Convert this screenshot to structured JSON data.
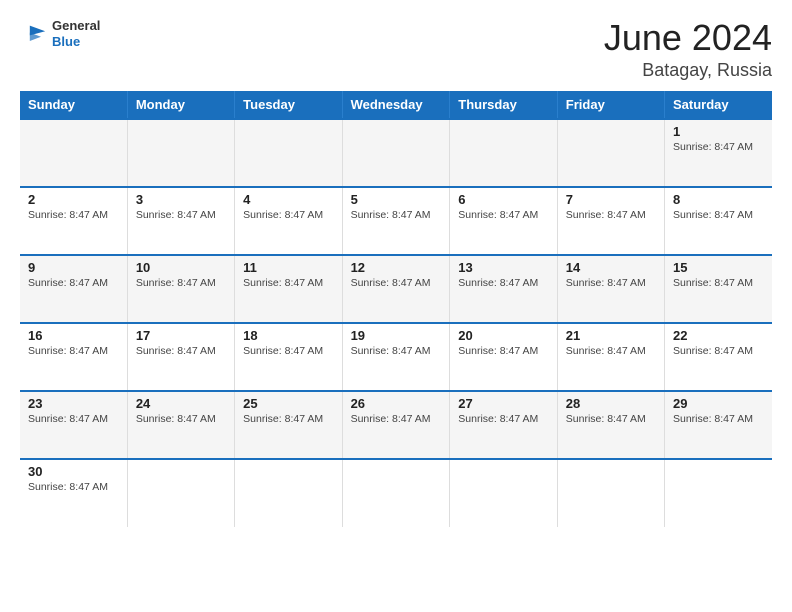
{
  "header": {
    "logo_line1": "General",
    "logo_line2": "Blue",
    "title": "June 2024",
    "subtitle": "Batagay, Russia"
  },
  "days_of_week": [
    "Sunday",
    "Monday",
    "Tuesday",
    "Wednesday",
    "Thursday",
    "Friday",
    "Saturday"
  ],
  "sunrise_text": "Sunrise: 8:47 AM",
  "weeks": [
    {
      "days": [
        {
          "num": "",
          "info": ""
        },
        {
          "num": "",
          "info": ""
        },
        {
          "num": "",
          "info": ""
        },
        {
          "num": "",
          "info": ""
        },
        {
          "num": "",
          "info": ""
        },
        {
          "num": "",
          "info": ""
        },
        {
          "num": "1",
          "info": "Sunrise: 8:47 AM"
        }
      ]
    },
    {
      "days": [
        {
          "num": "2",
          "info": "Sunrise: 8:47 AM"
        },
        {
          "num": "3",
          "info": "Sunrise: 8:47 AM"
        },
        {
          "num": "4",
          "info": "Sunrise: 8:47 AM"
        },
        {
          "num": "5",
          "info": "Sunrise: 8:47 AM"
        },
        {
          "num": "6",
          "info": "Sunrise: 8:47 AM"
        },
        {
          "num": "7",
          "info": "Sunrise: 8:47 AM"
        },
        {
          "num": "8",
          "info": "Sunrise: 8:47 AM"
        }
      ]
    },
    {
      "days": [
        {
          "num": "9",
          "info": "Sunrise: 8:47 AM"
        },
        {
          "num": "10",
          "info": "Sunrise: 8:47 AM"
        },
        {
          "num": "11",
          "info": "Sunrise: 8:47 AM"
        },
        {
          "num": "12",
          "info": "Sunrise: 8:47 AM"
        },
        {
          "num": "13",
          "info": "Sunrise: 8:47 AM"
        },
        {
          "num": "14",
          "info": "Sunrise: 8:47 AM"
        },
        {
          "num": "15",
          "info": "Sunrise: 8:47 AM"
        }
      ]
    },
    {
      "days": [
        {
          "num": "16",
          "info": "Sunrise: 8:47 AM"
        },
        {
          "num": "17",
          "info": "Sunrise: 8:47 AM"
        },
        {
          "num": "18",
          "info": "Sunrise: 8:47 AM"
        },
        {
          "num": "19",
          "info": "Sunrise: 8:47 AM"
        },
        {
          "num": "20",
          "info": "Sunrise: 8:47 AM"
        },
        {
          "num": "21",
          "info": "Sunrise: 8:47 AM"
        },
        {
          "num": "22",
          "info": "Sunrise: 8:47 AM"
        }
      ]
    },
    {
      "days": [
        {
          "num": "23",
          "info": "Sunrise: 8:47 AM"
        },
        {
          "num": "24",
          "info": "Sunrise: 8:47 AM"
        },
        {
          "num": "25",
          "info": "Sunrise: 8:47 AM"
        },
        {
          "num": "26",
          "info": "Sunrise: 8:47 AM"
        },
        {
          "num": "27",
          "info": "Sunrise: 8:47 AM"
        },
        {
          "num": "28",
          "info": "Sunrise: 8:47 AM"
        },
        {
          "num": "29",
          "info": "Sunrise: 8:47 AM"
        }
      ]
    },
    {
      "days": [
        {
          "num": "30",
          "info": "Sunrise: 8:47 AM"
        },
        {
          "num": "",
          "info": ""
        },
        {
          "num": "",
          "info": ""
        },
        {
          "num": "",
          "info": ""
        },
        {
          "num": "",
          "info": ""
        },
        {
          "num": "",
          "info": ""
        },
        {
          "num": "",
          "info": ""
        }
      ]
    }
  ]
}
